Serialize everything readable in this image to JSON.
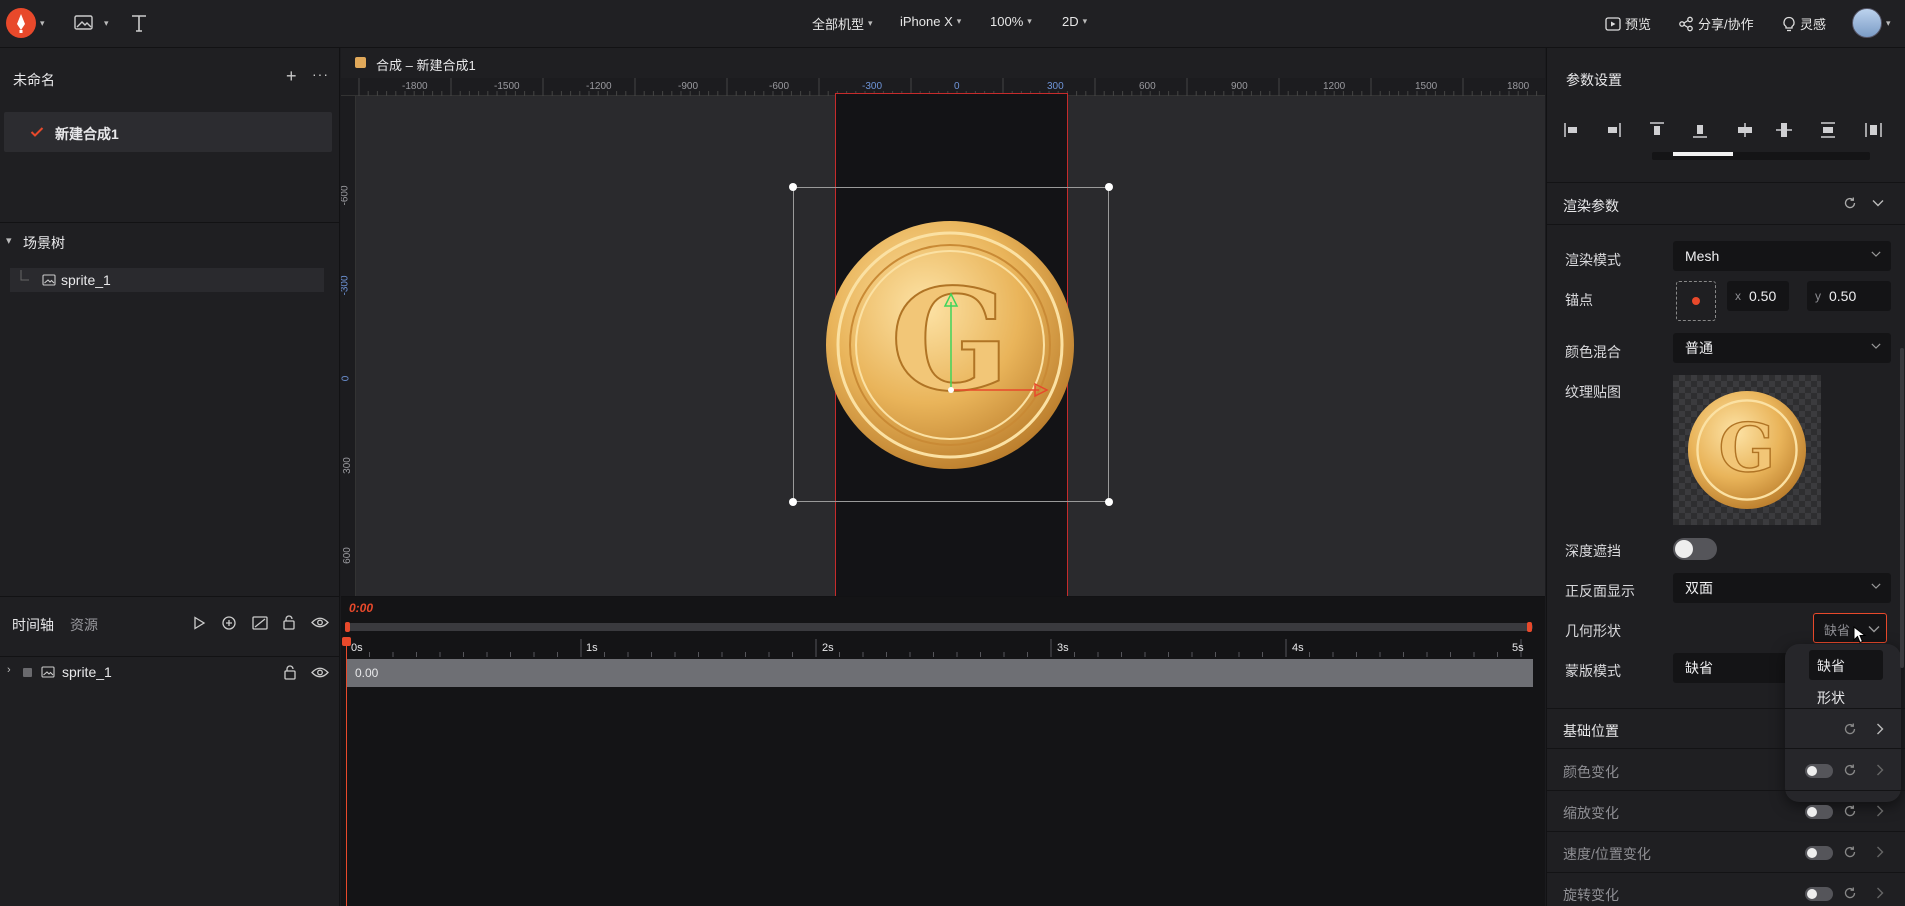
{
  "topbar": {
    "device_select": "全部机型",
    "model_select": "iPhone X",
    "zoom_select": "100%",
    "mode_select": "2D",
    "preview": "预览",
    "share": "分享/协作",
    "inspiration": "灵感"
  },
  "project": {
    "name": "未命名",
    "composition": "新建合成1"
  },
  "scene_tree": {
    "title": "场景树",
    "item": "sprite_1"
  },
  "canvas": {
    "tab_title": "合成 – 新建合成1",
    "ruler_x": [
      "-1800",
      "-1500",
      "-1200",
      "-900",
      "-600",
      "-300",
      "0",
      "300",
      "600",
      "900",
      "1200",
      "1500",
      "1800"
    ],
    "ruler_y": [
      "-600",
      "-300",
      "0",
      "300",
      "600"
    ],
    "sprite_letter": "G"
  },
  "timeline": {
    "tab_timeline": "时间轴",
    "tab_assets": "资源",
    "current_time": "0:00",
    "ticks": [
      "0s",
      "1s",
      "2s",
      "3s",
      "4s",
      "5s"
    ],
    "track_name": "sprite_1",
    "track_value": "0.00"
  },
  "panel": {
    "title": "参数设置",
    "render_section": "渲染参数",
    "render_mode_label": "渲染模式",
    "render_mode_value": "Mesh",
    "anchor_label": "锚点",
    "anchor_x_label": "x",
    "anchor_x": "0.50",
    "anchor_y_label": "y",
    "anchor_y": "0.50",
    "blend_label": "颜色混合",
    "blend_value": "普通",
    "texture_label": "纹理贴图",
    "depth_label": "深度遮挡",
    "side_label": "正反面显示",
    "side_value": "双面",
    "geometry_label": "几何形状",
    "geometry_value": "缺省",
    "mask_label": "蒙版模式",
    "mask_value": "缺省",
    "dropdown_options": [
      "缺省",
      "形状"
    ],
    "base_position": "基础位置",
    "color_change": "颜色变化",
    "scale_change": "缩放变化",
    "speed_change": "速度/位置变化",
    "rotate_change": "旋转变化"
  },
  "colors": {
    "accent": "#e8492b",
    "coin_gold": "#e9b45a",
    "bg": "#1f1f22"
  }
}
